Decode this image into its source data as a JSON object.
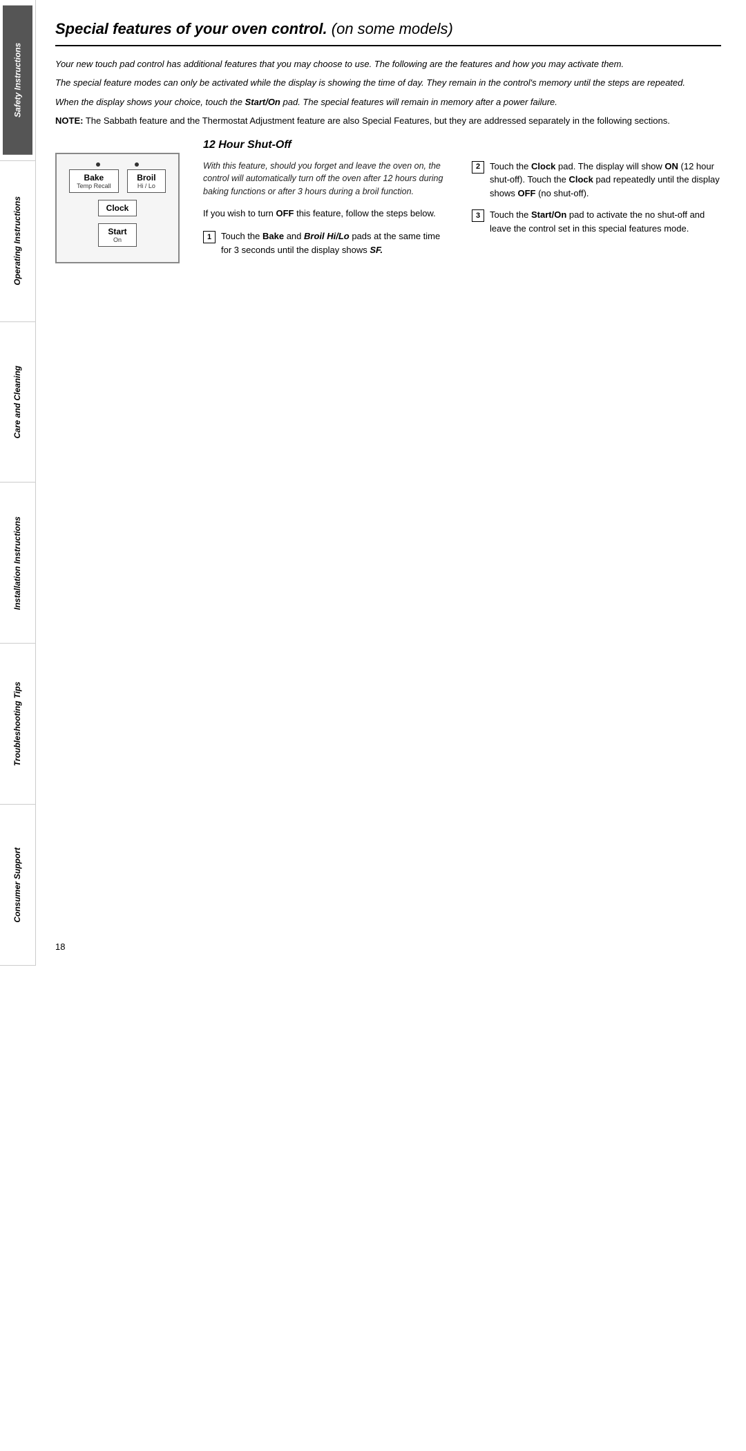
{
  "sidebar": {
    "sections": [
      {
        "id": "safety",
        "label": "Safety Instructions",
        "dark": true
      },
      {
        "id": "operating",
        "label": "Operating Instructions",
        "dark": false
      },
      {
        "id": "care",
        "label": "Care and Cleaning",
        "dark": false
      },
      {
        "id": "installation",
        "label": "Installation Instructions",
        "dark": false
      },
      {
        "id": "troubleshooting",
        "label": "Troubleshooting Tips",
        "dark": false
      },
      {
        "id": "consumer",
        "label": "Consumer Support",
        "dark": false
      }
    ]
  },
  "page": {
    "title": "Special features of your oven control.",
    "title_subtitle": " (on some models)",
    "intro1": "Your new touch pad control has additional features that you may choose to use. The following are the features and how you may activate them.",
    "intro2": "The special feature modes can only be activated while the display is showing the time of day. They remain in the control's memory until the steps are repeated.",
    "intro3_start": "When the display shows your choice, touch the ",
    "intro3_bold": "Start/On",
    "intro3_end": " pad. The special features will remain in memory after a power failure.",
    "note_label": "NOTE:",
    "note_text": " The Sabbath feature and the Thermostat Adjustment feature are also Special Features, but they are addressed separately in the following sections.",
    "section_heading": "12 Hour Shut-Off",
    "feature_intro": "With this feature, should you forget and leave the oven on, the control will automatically turn off the oven after 12 hours during baking functions or after 3 hours during a broil function.",
    "off_instruction_start": "If you wish to turn ",
    "off_instruction_bold": "OFF",
    "off_instruction_end": " this feature, follow the steps below.",
    "steps": [
      {
        "num": "1",
        "text_parts": [
          {
            "type": "text",
            "value": "Touch the "
          },
          {
            "type": "bold",
            "value": "Bake"
          },
          {
            "type": "text",
            "value": " and "
          },
          {
            "type": "bold-italic",
            "value": "Broil Hi/Lo"
          },
          {
            "type": "text",
            "value": " pads at the same time for 3 seconds until the display shows "
          },
          {
            "type": "bold-italic",
            "value": "SF."
          }
        ]
      },
      {
        "num": "2",
        "text_parts": [
          {
            "type": "text",
            "value": "Touch the "
          },
          {
            "type": "bold",
            "value": "Clock"
          },
          {
            "type": "text",
            "value": " pad. The display will show "
          },
          {
            "type": "bold",
            "value": "ON"
          },
          {
            "type": "text",
            "value": " (12 hour shut-off). Touch the "
          },
          {
            "type": "bold",
            "value": "Clock"
          },
          {
            "type": "text",
            "value": " pad repeatedly until the display shows "
          },
          {
            "type": "bold",
            "value": "OFF"
          },
          {
            "type": "text",
            "value": " (no shut-off)."
          }
        ]
      },
      {
        "num": "3",
        "text_parts": [
          {
            "type": "text",
            "value": "Touch the "
          },
          {
            "type": "bold",
            "value": "Start/On"
          },
          {
            "type": "text",
            "value": " pad to activate the no shut-off and leave the control set in this special features mode."
          }
        ]
      }
    ],
    "diagram": {
      "bake_label": "Bake",
      "bake_sub": "Temp Recall",
      "broil_label": "Broil",
      "broil_sub": "Hi / Lo",
      "clock_label": "Clock",
      "start_label": "Start",
      "start_sub": "On"
    },
    "page_number": "18"
  }
}
